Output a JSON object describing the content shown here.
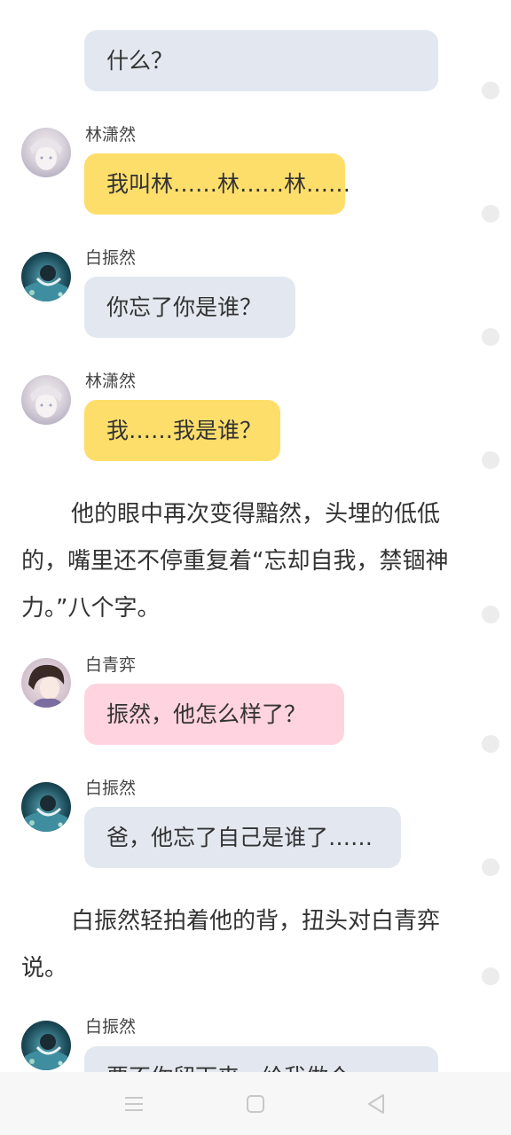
{
  "messages": [
    {
      "type": "partial",
      "text": "什么？",
      "color": "#e3e8f0"
    },
    {
      "type": "chat",
      "speaker": "林潇然",
      "avatar": "avatar-lin",
      "text": "我叫林……林……林……",
      "color": "#fede6b"
    },
    {
      "type": "chat",
      "speaker": "白振然",
      "avatar": "avatar-bai-zhenran",
      "text": "你忘了你是谁？",
      "color": "#e3e8f0"
    },
    {
      "type": "chat",
      "speaker": "林潇然",
      "avatar": "avatar-lin",
      "text": "我……我是谁？",
      "color": "#fede6b"
    },
    {
      "type": "narration",
      "text": "他的眼中再次变得黯然，头埋的低低的，嘴里还不停重复着“忘却自我，禁锢神力。”八个字。"
    },
    {
      "type": "chat",
      "speaker": "白青弈",
      "avatar": "avatar-bai-qingyi",
      "text": "振然，他怎么样了？",
      "color": "#ffd3df"
    },
    {
      "type": "chat",
      "speaker": "白振然",
      "avatar": "avatar-bai-zhenran",
      "text": "爸，他忘了自己是谁了……",
      "color": "#e3e8f0"
    },
    {
      "type": "narration",
      "text": "白振然轻拍着他的背，扭头对白青弈说。"
    },
    {
      "type": "chat",
      "speaker": "白振然",
      "avatar": "avatar-bai-zhenran",
      "text": "要不你留下来，给我做个",
      "color": "#e3e8f0"
    }
  ],
  "nav": {
    "menu_icon": "menu-icon",
    "home_icon": "home-square-icon",
    "back_icon": "back-triangle-icon"
  }
}
